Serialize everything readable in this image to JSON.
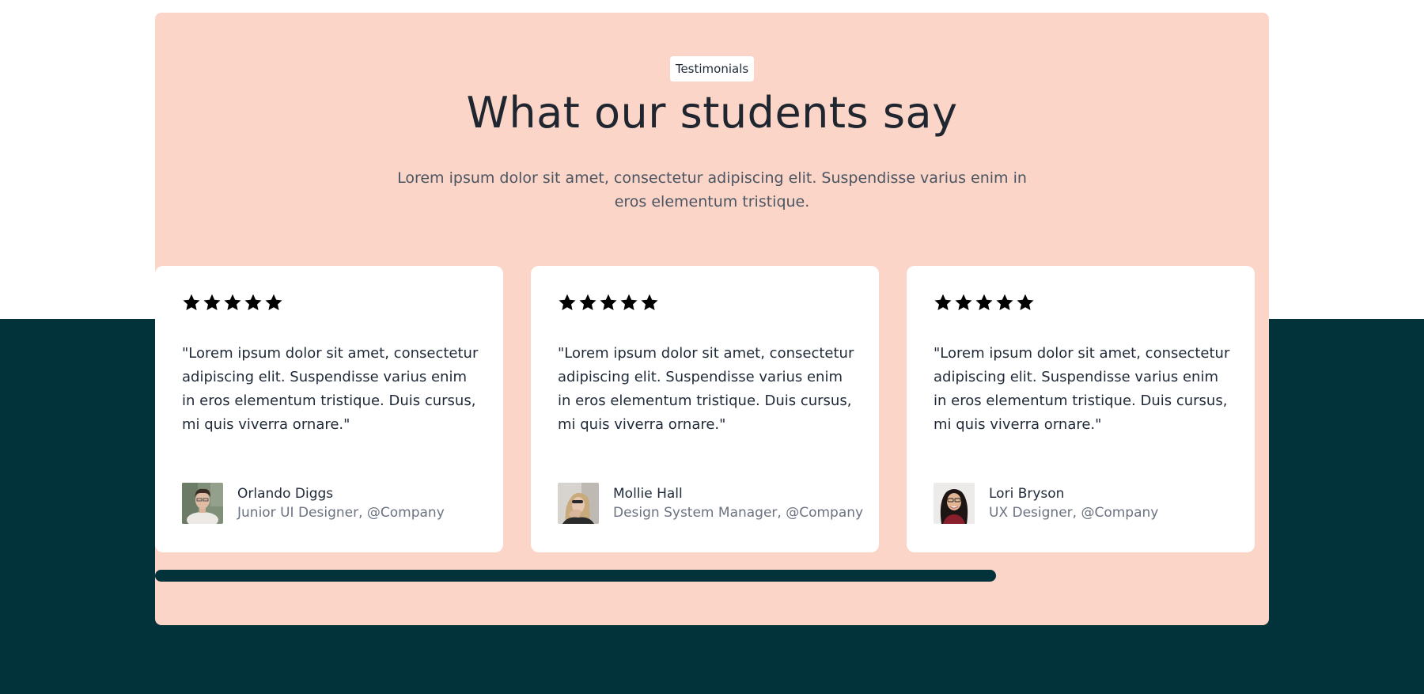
{
  "colors": {
    "panel_bg": "#fbd5c7",
    "dark_band": "#02333b",
    "star": "#000000",
    "scrollbar": "#02333b"
  },
  "header": {
    "tag": "Testimonials",
    "title": "What our students say",
    "subtitle": "Lorem ipsum dolor sit amet, consectetur adipiscing elit. Suspendisse varius enim in eros elementum tristique."
  },
  "testimonials": [
    {
      "rating": 5,
      "quote": "\"Lorem ipsum dolor sit amet, consectetur adipiscing elit. Suspendisse varius enim in eros elementum tristique. Duis cursus, mi quis viverra ornare.\"",
      "name": "Orlando Diggs",
      "role": "Junior UI Designer, @Company",
      "avatar_icon": "person-photo-male"
    },
    {
      "rating": 5,
      "quote": "\"Lorem ipsum dolor sit amet, consectetur adipiscing elit. Suspendisse varius enim in eros elementum tristique. Duis cursus, mi quis viverra ornare.\"",
      "name": "Mollie Hall",
      "role": "Design System Manager, @Company",
      "avatar_icon": "person-photo-female-blonde"
    },
    {
      "rating": 5,
      "quote": "\"Lorem ipsum dolor sit amet, consectetur adipiscing elit. Suspendisse varius enim in eros elementum tristique. Duis cursus, mi quis viverra ornare.\"",
      "name": "Lori Bryson",
      "role": "UX Designer, @Company",
      "avatar_icon": "person-photo-female-glasses"
    }
  ],
  "carousel": {
    "scroll_progress": 0.755
  }
}
